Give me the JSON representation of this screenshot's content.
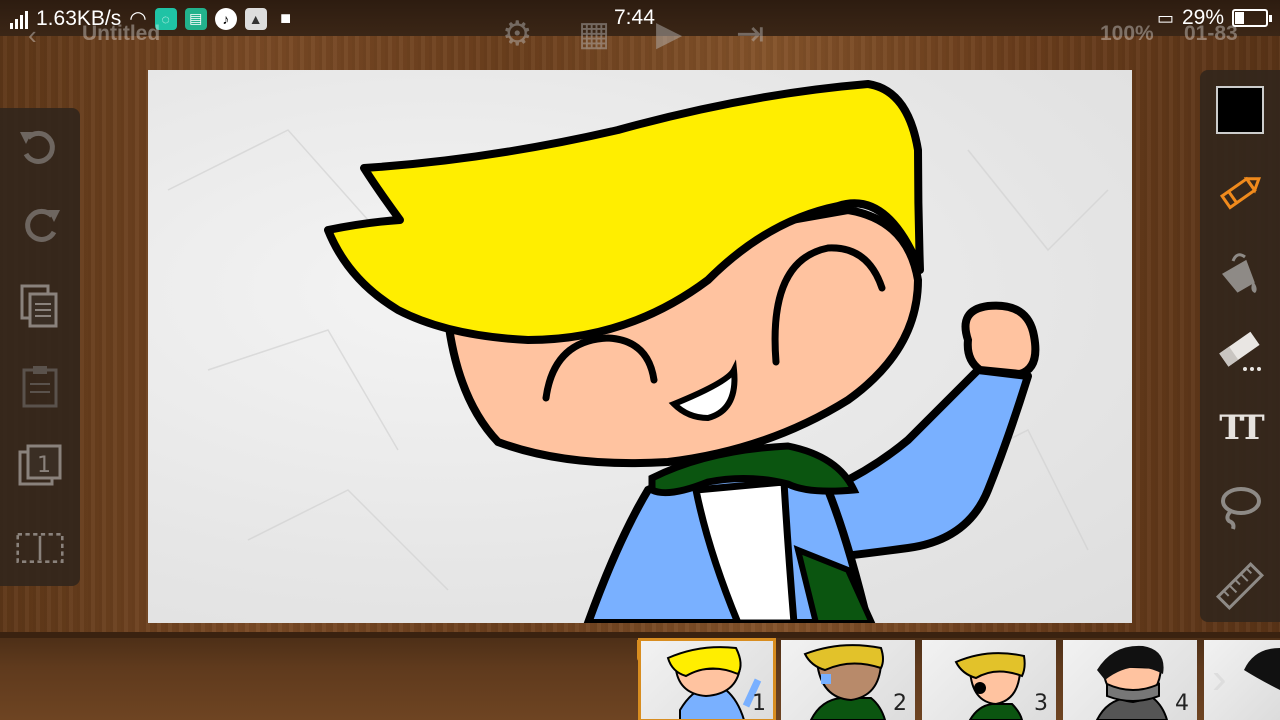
{
  "status_bar": {
    "net_speed": "1.63KB/s",
    "time": "7:44",
    "battery_percent": "29%",
    "battery_level": 0.29
  },
  "toolbar": {
    "title": "Untitled",
    "zoom": "100%",
    "frame_counter": "01-83"
  },
  "left_tools": [
    {
      "name": "undo",
      "icon": "undo-icon"
    },
    {
      "name": "redo",
      "icon": "redo-icon"
    },
    {
      "name": "copy",
      "icon": "copy-icon"
    },
    {
      "name": "paste",
      "icon": "paste-icon"
    },
    {
      "name": "layer",
      "icon": "layer-icon",
      "label": "1"
    },
    {
      "name": "select",
      "icon": "selection-icon"
    }
  ],
  "right_tools": {
    "current_color": "#000000",
    "items": [
      {
        "name": "pencil",
        "icon": "pencil-icon",
        "active": true
      },
      {
        "name": "fill",
        "icon": "paint-bucket-icon"
      },
      {
        "name": "eraser",
        "icon": "eraser-icon"
      },
      {
        "name": "text",
        "icon": "text-icon",
        "label": "TT"
      },
      {
        "name": "lasso",
        "icon": "lasso-icon"
      },
      {
        "name": "ruler",
        "icon": "ruler-icon"
      }
    ]
  },
  "frames": [
    {
      "number": "1",
      "active": true
    },
    {
      "number": "2",
      "active": false
    },
    {
      "number": "3",
      "active": false
    },
    {
      "number": "4",
      "active": false
    }
  ],
  "colors": {
    "accent": "#d88d20",
    "hair": "#ffee00",
    "skin": "#ffc3a0",
    "jacket": "#79b0ff",
    "scarf": "#0b5510"
  }
}
